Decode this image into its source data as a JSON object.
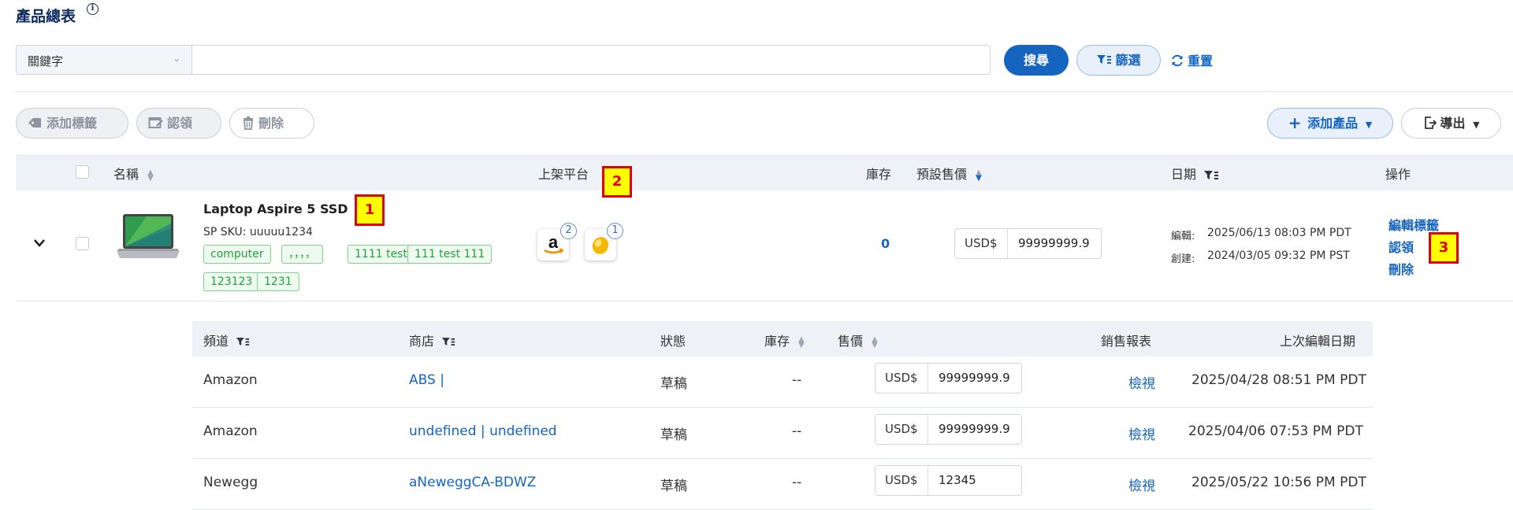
{
  "header": {
    "title": "產品總表",
    "info_icon": "info-icon"
  },
  "search": {
    "field_select": "關鍵字",
    "input_value": "",
    "search_label": "搜尋",
    "filter_label": "篩選",
    "reset_label": "重置"
  },
  "toolbar": {
    "add_tag_label": "添加標籤",
    "claim_label": "認領",
    "delete_label": "刪除",
    "add_product_label": "添加產品",
    "export_label": "導出"
  },
  "table": {
    "columns": {
      "name": "名稱",
      "platform": "上架平台",
      "stock": "庫存",
      "default_price": "預設售價",
      "date": "日期",
      "actions": "操作"
    },
    "product": {
      "name": "Laptop Aspire 5 SSD",
      "sku": "SP SKU: uuuuu1234",
      "tags": [
        "computer",
        "，，，，",
        "1111 test",
        "111 test 111",
        "123123",
        "1231"
      ],
      "platforms": [
        {
          "icon": "amazon-icon",
          "count": "2"
        },
        {
          "icon": "newegg-icon",
          "count": "1"
        }
      ],
      "stock": "0",
      "currency": "USD$",
      "price": "99999999.9",
      "edited_label": "編輯:",
      "edited_date": "2025/06/13 08:03 PM PDT",
      "created_label": "創建:",
      "created_date": "2024/03/05 09:32 PM PST",
      "actions": [
        "編輯標籤",
        "認領",
        "刪除"
      ]
    },
    "annotations": [
      "1",
      "2",
      "3"
    ]
  },
  "sub_table": {
    "columns": {
      "channel": "頻道",
      "store": "商店",
      "status": "狀態",
      "stock": "庫存",
      "price": "售價",
      "report": "銷售報表",
      "last_edit": "上次編輯日期"
    },
    "rows": [
      {
        "channel": "Amazon",
        "store": "ABS |",
        "status": "草稿",
        "stock": "--",
        "currency": "USD$",
        "price": "99999999.9",
        "report": "檢視",
        "last_edit": "2025/04/28 08:51 PM PDT"
      },
      {
        "channel": "Amazon",
        "store": "undefined | undefined",
        "status": "草稿",
        "stock": "--",
        "currency": "USD$",
        "price": "99999999.9",
        "report": "檢視",
        "last_edit": "2025/04/06 07:53 PM PDT"
      },
      {
        "channel": "Newegg",
        "store": "aNeweggCA-BDWZ",
        "status": "草稿",
        "stock": "--",
        "currency": "USD$",
        "price": "12345",
        "report": "檢視",
        "last_edit": "2025/05/22 10:56 PM PDT"
      }
    ]
  },
  "colors": {
    "primary": "#1565c0",
    "tag_green": "#22a23a",
    "annotation_red": "#e00000",
    "annotation_yellow": "#ffff00"
  }
}
